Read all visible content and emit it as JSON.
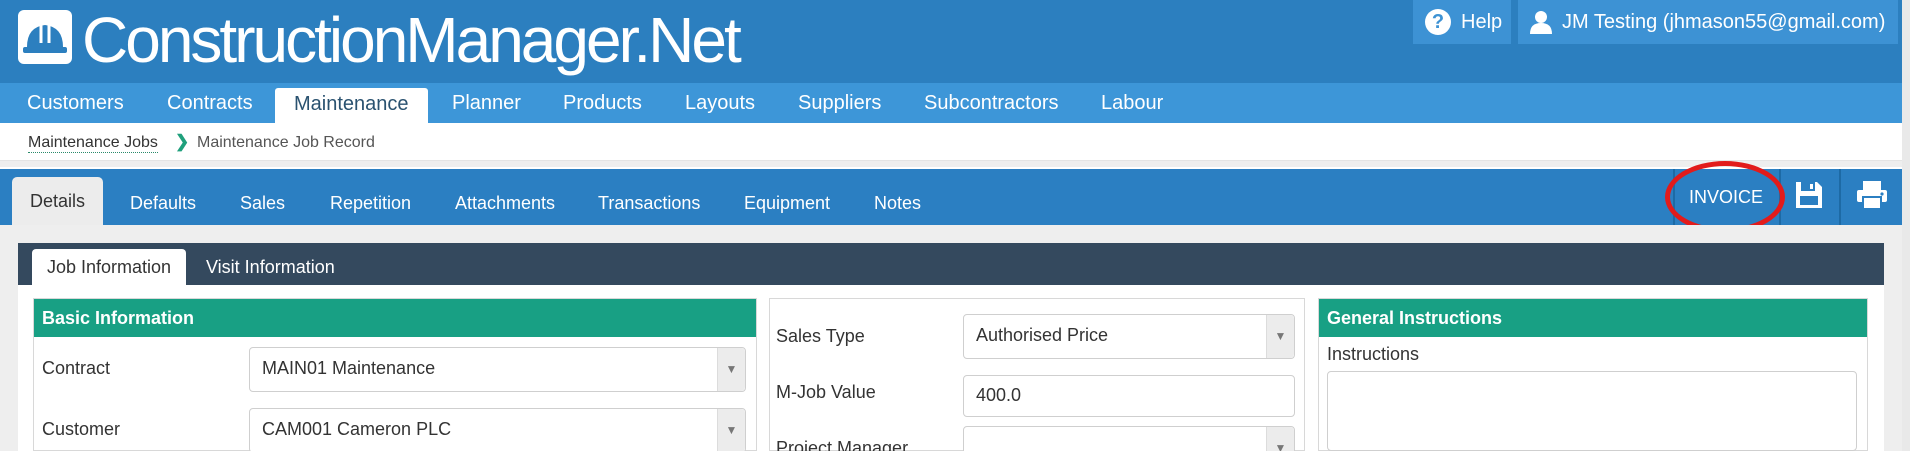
{
  "header": {
    "brand": "ConstructionManager.Net",
    "help_label": "Help",
    "user_label": "JM Testing (jhmason55@gmail.com)"
  },
  "main_nav": {
    "items": [
      {
        "label": "Customers"
      },
      {
        "label": "Contracts"
      },
      {
        "label": "Maintenance",
        "active": true
      },
      {
        "label": "Planner"
      },
      {
        "label": "Products"
      },
      {
        "label": "Layouts"
      },
      {
        "label": "Suppliers"
      },
      {
        "label": "Subcontractors"
      },
      {
        "label": "Labour"
      }
    ]
  },
  "breadcrumb": {
    "parent": "Maintenance Jobs",
    "current": "Maintenance Job Record"
  },
  "record_tabs": {
    "items": [
      {
        "label": "Details",
        "active": true
      },
      {
        "label": "Defaults"
      },
      {
        "label": "Sales"
      },
      {
        "label": "Repetition"
      },
      {
        "label": "Attachments"
      },
      {
        "label": "Transactions"
      },
      {
        "label": "Equipment"
      },
      {
        "label": "Notes"
      }
    ]
  },
  "toolbar": {
    "invoice_label": "INVOICE",
    "save_icon": "floppy-disk-icon",
    "print_icon": "printer-icon"
  },
  "sub_tabs": {
    "items": [
      {
        "label": "Job Information",
        "active": true
      },
      {
        "label": "Visit Information"
      }
    ]
  },
  "basic_info": {
    "title": "Basic Information",
    "contract_label": "Contract",
    "contract_value": "MAIN01 Maintenance",
    "customer_label": "Customer",
    "customer_value": "CAM001 Cameron PLC"
  },
  "sales_info": {
    "sales_type_label": "Sales Type",
    "sales_type_value": "Authorised Price",
    "mjob_value_label": "M-Job Value",
    "mjob_value": "400.0",
    "project_manager_label": "Project Manager",
    "project_manager_value": ""
  },
  "general_instructions": {
    "title": "General Instructions",
    "instructions_label": "Instructions",
    "instructions_value": ""
  },
  "colors": {
    "header_blue": "#2c7fbf",
    "nav_blue": "#3d96d8",
    "section_green": "#18a084",
    "subtab_dark": "#34495e",
    "highlight_red": "#e21b1b"
  }
}
